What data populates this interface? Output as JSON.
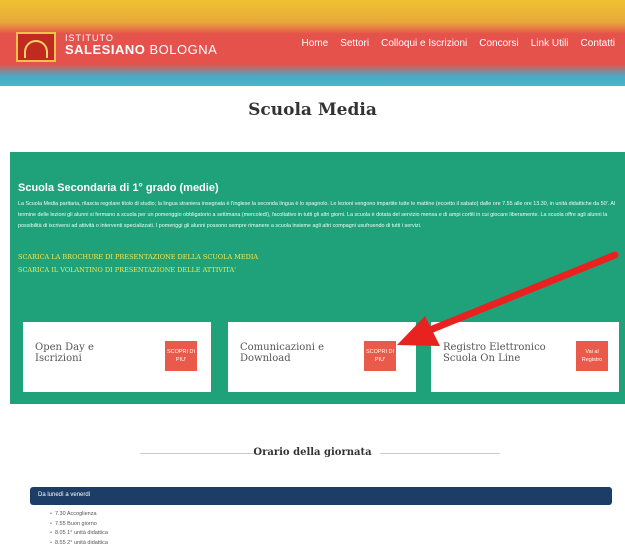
{
  "header": {
    "logo_line1": "ISTITUTO",
    "logo_line2_bold": "SALESIANO",
    "logo_line2_light": " BOLOGNA",
    "nav": [
      "Home",
      "Settori",
      "Colloqui e Iscrizioni",
      "Concorsi",
      "Link Utili",
      "Contatti"
    ]
  },
  "page_title": "Scuola Media",
  "section": {
    "heading": "Scuola Secondaria di 1° grado (medie)",
    "body": "La Scuola Media paritaria, rilascia regolare titolo di studio; la lingua straniera insegnata è l'inglese la seconda lingua è lo spagnolo. Le lezioni vengono impartite tutte le mattine (eccetto il sabato) dalle ore 7.55 alle ore 13.30, in unità didattiche da 50'. Al termine delle lezioni gli alunni si fermano a scuola per un pomeriggio obbligatorio a settimana (mercoledì), facoltativo in tutti gli altri giorni. La scuola è dotata del servizio mensa e di ampi cortili in cui giocare liberamente. La scuola offre agli alunni la possibilità di iscriversi ad attività o interventi specializzati. I pomeriggi gli alunni possono sempre rimanere a scuola insieme agli altri compagni usufruendo di tutti i servizi.",
    "link_brochure": "SCARICA LA BROCHURE DI PRESENTAZIONE DELLA SCUOLA MEDIA",
    "link_volantino": "SCARICA IL VOLANTINO DI PRESENTAZIONE DELLE ATTIVITA'"
  },
  "cards": [
    {
      "label": "Open Day e Iscrizioni",
      "button": "SCOPRI DI PIU'"
    },
    {
      "label": "Comunicazioni e Download",
      "button": "SCOPRI DI PIU'"
    },
    {
      "label": "Registro Elettronico Scuola On Line",
      "button": "Vai al Registro"
    }
  ],
  "orario": {
    "title": "Orario della giornata",
    "bar_label": "Da lunedì a venerdì",
    "items": [
      "7.30 Accoglienza",
      "7.55 Buon giorno",
      "8.05 1° unità didattica",
      "8.55 2° unità didattica"
    ]
  },
  "colors": {
    "header_red": "#e5524b",
    "header_yellow": "#f1c232",
    "header_teal": "#47b6cf",
    "section_green": "#1fa27a",
    "button_red": "#ea5a4b",
    "link_yellow": "#f5e64b",
    "bar_navy": "#1c3e66",
    "arrow_red": "#e8231f"
  }
}
